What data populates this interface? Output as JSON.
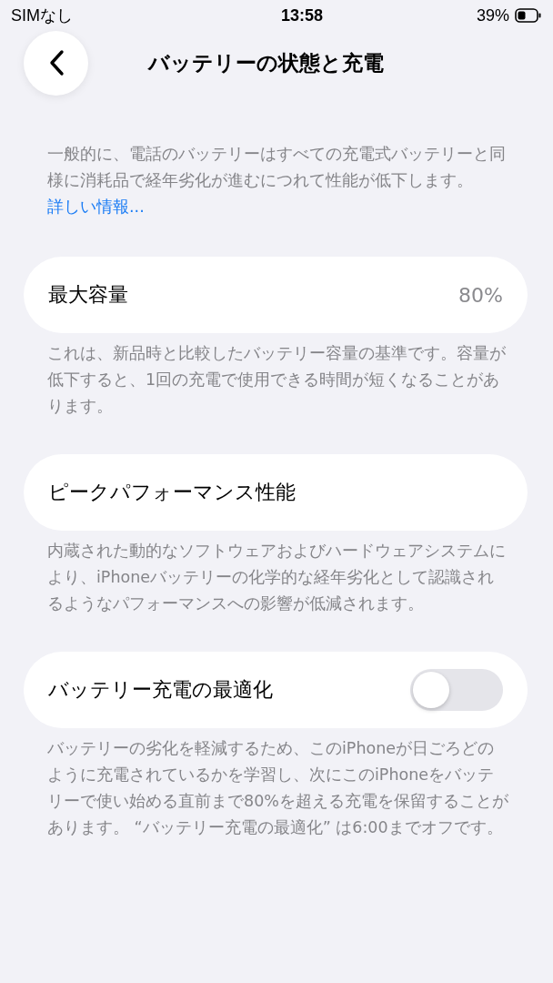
{
  "status_bar": {
    "carrier": "SIMなし",
    "time": "13:58",
    "battery": "39%"
  },
  "nav": {
    "title": "バッテリーの状態と充電"
  },
  "intro": {
    "text": "一般的に、電話のバッテリーはすべての充電式バッテリーと同様に消耗品で経年劣化が進むにつれて性能が低下します。",
    "link": "詳しい情報..."
  },
  "sections": [
    {
      "kind": "value",
      "label": "最大容量",
      "value": "80%",
      "footer": "これは、新品時と比較したバッテリー容量の基準です。容量が低下すると、1回の充電で使用できる時間が短くなることがあります。"
    },
    {
      "kind": "plain",
      "label": "ピークパフォーマンス性能",
      "footer": "内蔵された動的なソフトウェアおよびハードウェアシステムにより、iPhoneバッテリーの化学的な経年劣化として認識されるようなパフォーマンスへの影響が低減されます。"
    },
    {
      "kind": "toggle",
      "label": "バッテリー充電の最適化",
      "on": false,
      "footer": "バッテリーの劣化を軽減するため、このiPhoneが日ごろどのように充電されているかを学習し、次にこのiPhoneをバッテリーで使い始める直前まで80%を超える充電を保留することがあります。 “バッテリー充電の最適化” は6:00までオフです。"
    }
  ]
}
